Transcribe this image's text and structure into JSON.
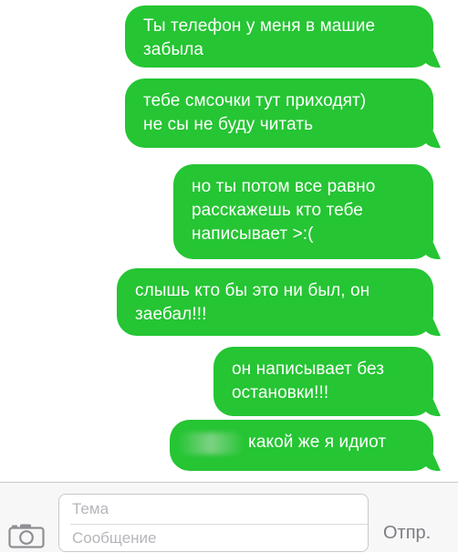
{
  "messages": [
    {
      "text": "Ты телефон у меня в машие\nзабыла",
      "direction": "outgoing"
    },
    {
      "text": "тебе смсочки тут приходят)\nне сы не буду читать",
      "direction": "outgoing"
    },
    {
      "text": "но ты потом все равно\nрасскажешь кто тебе\nнаписывает >:(",
      "direction": "outgoing"
    },
    {
      "text": "слышь кто бы это ни был, он\nзаебал!!!",
      "direction": "outgoing"
    },
    {
      "text": "он написывает без\nостановки!!!",
      "direction": "outgoing"
    },
    {
      "text": "какой же я идиот",
      "direction": "outgoing"
    }
  ],
  "composer": {
    "subject_placeholder": "Тема",
    "message_placeholder": "Сообщение",
    "send_label": "Отпр."
  },
  "colors": {
    "bubble": "#25c533",
    "bubble_text": "#ffffff",
    "placeholder": "#b6b6bb",
    "send_disabled": "#7d7d82"
  },
  "icons": {
    "camera": "camera-icon"
  }
}
